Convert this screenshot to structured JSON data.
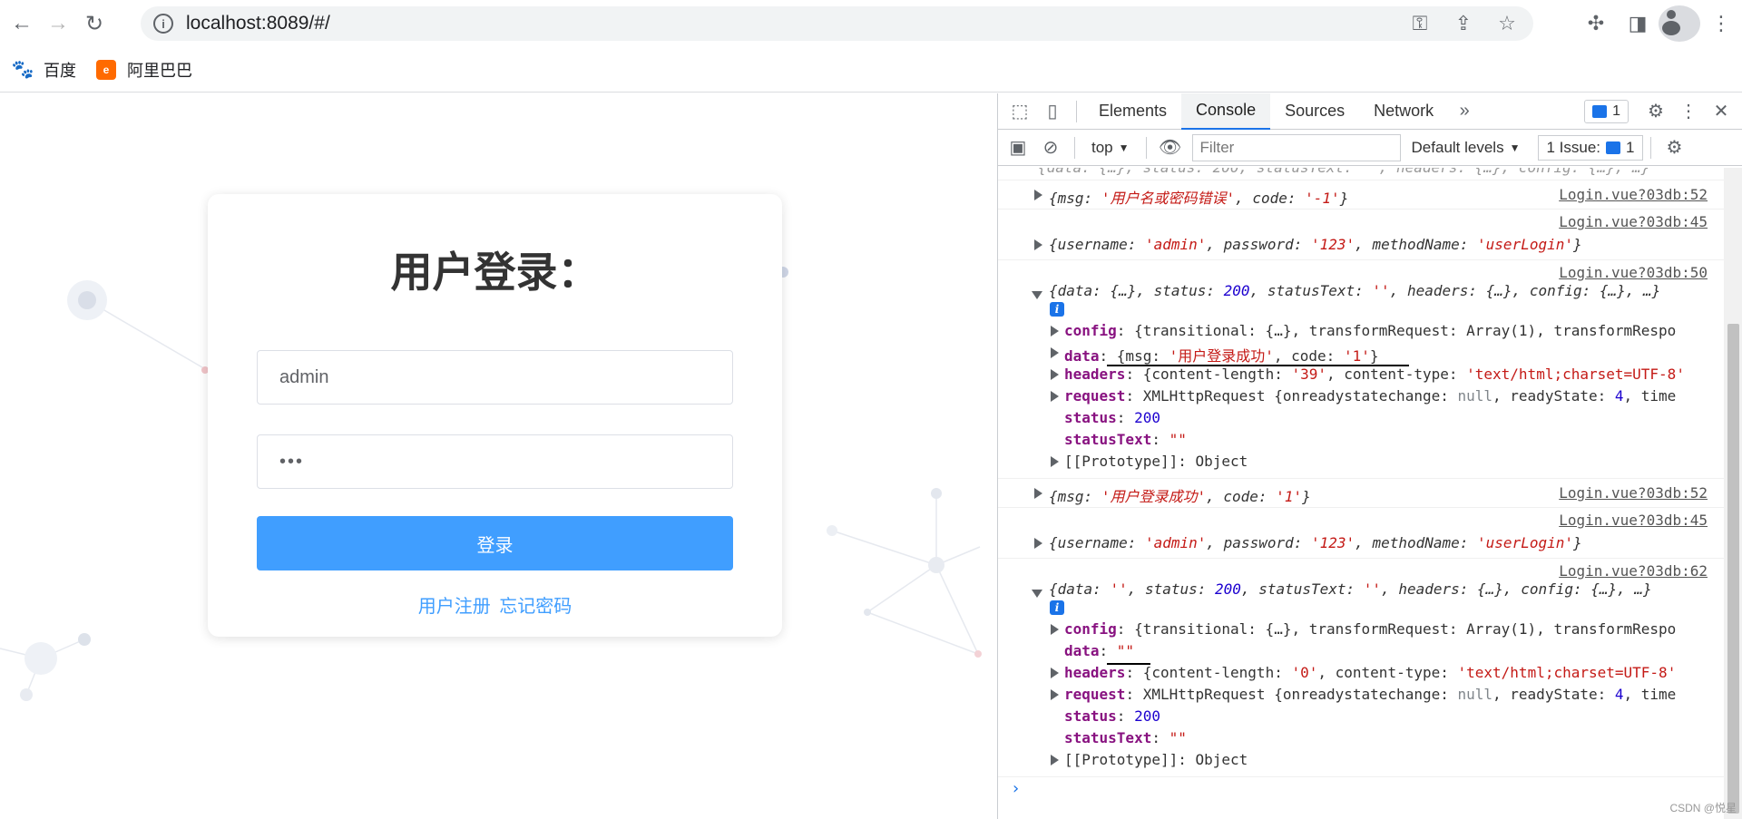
{
  "browser": {
    "url": "localhost:8089/#/",
    "bookmarks": [
      {
        "label": "百度",
        "icon": "baidu-icon"
      },
      {
        "label": "阿里巴巴",
        "icon": "alibaba-icon"
      }
    ]
  },
  "login": {
    "title": "用户登录：",
    "username_value": "admin",
    "password_value": "•••",
    "login_label": "登录",
    "register_link": "用户注册",
    "forgot_link": "忘记密码"
  },
  "devtools": {
    "tabs": [
      "Elements",
      "Console",
      "Sources",
      "Network"
    ],
    "active_tab": "Console",
    "more_tabs": "»",
    "message_count": "1",
    "context": "top",
    "filter_placeholder": "Filter",
    "levels_label": "Default levels",
    "issues_label": "1 Issue:",
    "issues_count": "1",
    "colors": {
      "accent": "#1a73e8",
      "string": "#c41a16",
      "number": "#1c00cf",
      "key": "#881280"
    }
  },
  "console": {
    "source_52": "Login.vue?03db:52",
    "source_45": "Login.vue?03db:45",
    "source_50": "Login.vue?03db:50",
    "source_62": "Login.vue?03db:62",
    "err_msg": "'用户名或密码错误'",
    "err_code": "'-1'",
    "ok_msg": "'用户登录成功'",
    "ok_code": "'1'",
    "username": "'admin'",
    "password": "'123'",
    "method": "'userLogin'",
    "status": "200",
    "empty_str": "''",
    "content_length_39": "'39'",
    "content_length_0": "'0'",
    "content_type": "'text/html;charset=UTF-8'",
    "ready_state": "4",
    "status_text_val": "\"\"",
    "data_val_empty": "\"\""
  },
  "watermark": "CSDN @悦星"
}
